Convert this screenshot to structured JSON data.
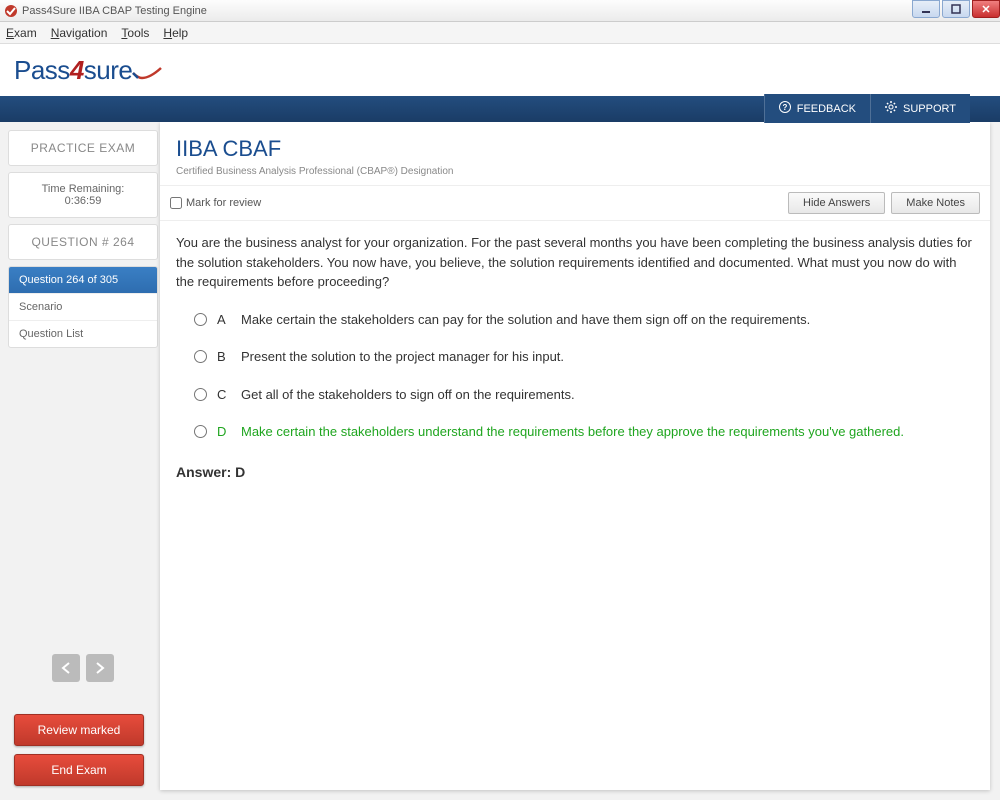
{
  "window": {
    "title": "Pass4Sure IIBA CBAP Testing Engine"
  },
  "menus": {
    "exam": "Exam",
    "navigation": "Navigation",
    "tools": "Tools",
    "help": "Help"
  },
  "logo": {
    "pass": "Pass",
    "four": "4",
    "sure": "sure"
  },
  "topButtons": {
    "feedback": "FEEDBACK",
    "support": "SUPPORT"
  },
  "sidebar": {
    "practice": "PRACTICE EXAM",
    "timeLabel": "Time Remaining:",
    "timeValue": "0:36:59",
    "questionNum": "QUESTION # 264",
    "tabs": {
      "progress": "Question 264 of 305",
      "scenario": "Scenario",
      "list": "Question List"
    }
  },
  "actions": {
    "review": "Review marked",
    "end": "End Exam"
  },
  "header": {
    "title": "IIBA CBAF",
    "subtitle": "Certified Business Analysis Professional (CBAP®) Designation"
  },
  "toolbar": {
    "mark": "Mark for review",
    "hide": "Hide Answers",
    "notes": "Make Notes"
  },
  "question": {
    "stem": "You are the business analyst for your organization. For the past several months you have been completing the business analysis duties for the solution stakeholders. You now have, you believe, the solution requirements identified and documented. What must you now do with the requirements before proceeding?",
    "options": {
      "a": {
        "letter": "A",
        "text": "Make certain the stakeholders can pay for the solution and have them sign off on the requirements."
      },
      "b": {
        "letter": "B",
        "text": "Present the solution to the project manager for his input."
      },
      "c": {
        "letter": "C",
        "text": "Get all of the stakeholders to sign off on the requirements."
      },
      "d": {
        "letter": "D",
        "text": "Make certain the stakeholders understand the requirements before they approve the requirements you've gathered."
      }
    },
    "answer": "Answer: D"
  }
}
